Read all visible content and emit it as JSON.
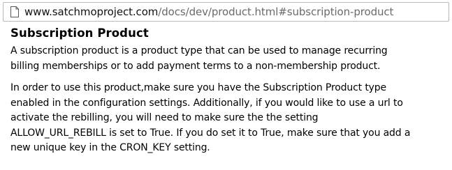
{
  "address_bar": {
    "icon": "page-icon",
    "url_host": "www.satchmoproject.com",
    "url_path": "/docs/dev/product.html#subscription-product"
  },
  "article": {
    "heading": "Subscription Product",
    "paragraph1": {
      "lines": [
        "A subscription product is a product type that can be used to manage recurring",
        "billing memberships or to add payment terms to a non-membership product."
      ]
    },
    "paragraph2": {
      "lines": [
        "In order to use this product,make sure you have the Subscription Product type",
        "enabled in the configuration settings. Additionally, if you would like to use a url to",
        "activate the rebilling, you will need to make sure the the setting",
        "ALLOW_URL_REBILL is set to True. If you do set it to True, make sure that you add a",
        "new unique key in the CRON_KEY setting."
      ]
    }
  }
}
